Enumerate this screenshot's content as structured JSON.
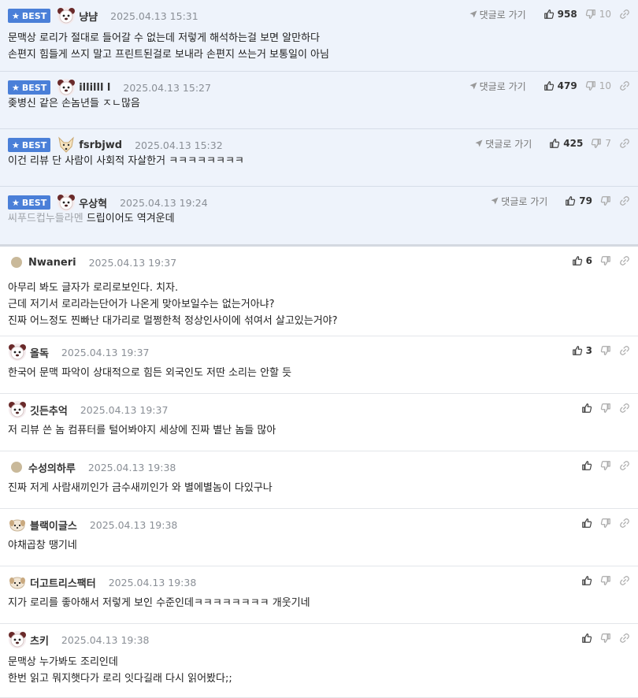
{
  "labels": {
    "best": "BEST",
    "reply": "댓글로 가기"
  },
  "comments": [
    {
      "best": true,
      "avatar": "dog-face-icon",
      "nick": "냥냠",
      "date": "2025.04.13 15:31",
      "up": "958",
      "down": "10",
      "lines": [
        "문맥상 로리가 절대로 들어갈 수 없는데 저렇게 해석하는걸 보면 알만하다",
        "손편지 힘들게 쓰지 말고 프린트된걸로 보내라 손편지 쓰는거 보통일이 아님"
      ],
      "muted_prefix": ""
    },
    {
      "best": true,
      "avatar": "dog-face-icon",
      "nick": "illilll l",
      "date": "2025.04.13 15:27",
      "up": "479",
      "down": "10",
      "lines": [
        "좆병신 같은 손놈년들 ㅈㄴ많음"
      ],
      "muted_prefix": ""
    },
    {
      "best": true,
      "avatar": "fox-face-icon",
      "nick": "fsrbjwd",
      "date": "2025.04.13 15:32",
      "up": "425",
      "down": "7",
      "lines": [
        "이건 리뷰 단 사람이 사회적 자살한거 ㅋㅋㅋㅋㅋㅋㅋㅋ"
      ],
      "muted_prefix": ""
    },
    {
      "best": true,
      "avatar": "dog-face-icon",
      "nick": "우상혁",
      "date": "2025.04.13 19:24",
      "up": "79",
      "down": "",
      "lines": [
        "드립이어도 역겨운데"
      ],
      "muted_prefix": "씨푸드컵누들라멘 "
    },
    {
      "best": false,
      "avatar": "dot-avatar",
      "nick": "Nwaneri",
      "date": "2025.04.13 19:37",
      "up": "6",
      "down": "",
      "lines": [
        "아무리 봐도 글자가 로리로보인다. 치자.",
        "근데 저기서 로리라는단어가 나온게 맞아보일수는 없는거아냐?",
        "진짜 어느정도 찐빠난 대가리로 멀쩡한척 정상인사이에 섞여서 살고있는거야?"
      ],
      "muted_prefix": ""
    },
    {
      "best": false,
      "avatar": "dog-face-icon",
      "nick": "올독",
      "date": "2025.04.13 19:37",
      "up": "3",
      "down": "",
      "lines": [
        "한국어 문맥 파악이 상대적으로 힘든 외국인도 저딴 소리는 안할 듯"
      ],
      "muted_prefix": ""
    },
    {
      "best": false,
      "avatar": "dog-face-icon",
      "nick": "깃든추억",
      "date": "2025.04.13 19:37",
      "up": "",
      "down": "",
      "lines": [
        "저 리뷰 쓴 놈 컴퓨터를 털어봐야지 세상에 진짜 별난 놈들 많아"
      ],
      "muted_prefix": ""
    },
    {
      "best": false,
      "avatar": "dot-avatar",
      "nick": "수성의하루",
      "date": "2025.04.13 19:38",
      "up": "",
      "down": "",
      "lines": [
        "진짜 저게 사람새끼인가 금수새끼인가 와 별에별놈이 다있구나"
      ],
      "muted_prefix": ""
    },
    {
      "best": false,
      "avatar": "puppy-icon",
      "nick": "블랙이글스",
      "date": "2025.04.13 19:38",
      "up": "",
      "down": "",
      "lines": [
        "야채곱창 땡기네"
      ],
      "muted_prefix": ""
    },
    {
      "best": false,
      "avatar": "puppy-small-icon",
      "nick": "더고트리스팩터",
      "date": "2025.04.13 19:38",
      "up": "",
      "down": "",
      "lines": [
        "지가 로리를 좋아해서 저렇게 보인 수준인데ㅋㅋㅋㅋㅋㅋㅋㅋ 개웃기네"
      ],
      "muted_prefix": ""
    },
    {
      "best": false,
      "avatar": "dog-face-icon",
      "nick": "츠키",
      "date": "2025.04.13 19:38",
      "up": "",
      "down": "",
      "lines": [
        "문맥상 누가봐도 조리인데",
        "한번 읽고 뭐지햇다가 로리 잇다길래 다시 읽어봤다;;"
      ],
      "muted_prefix": ""
    }
  ]
}
